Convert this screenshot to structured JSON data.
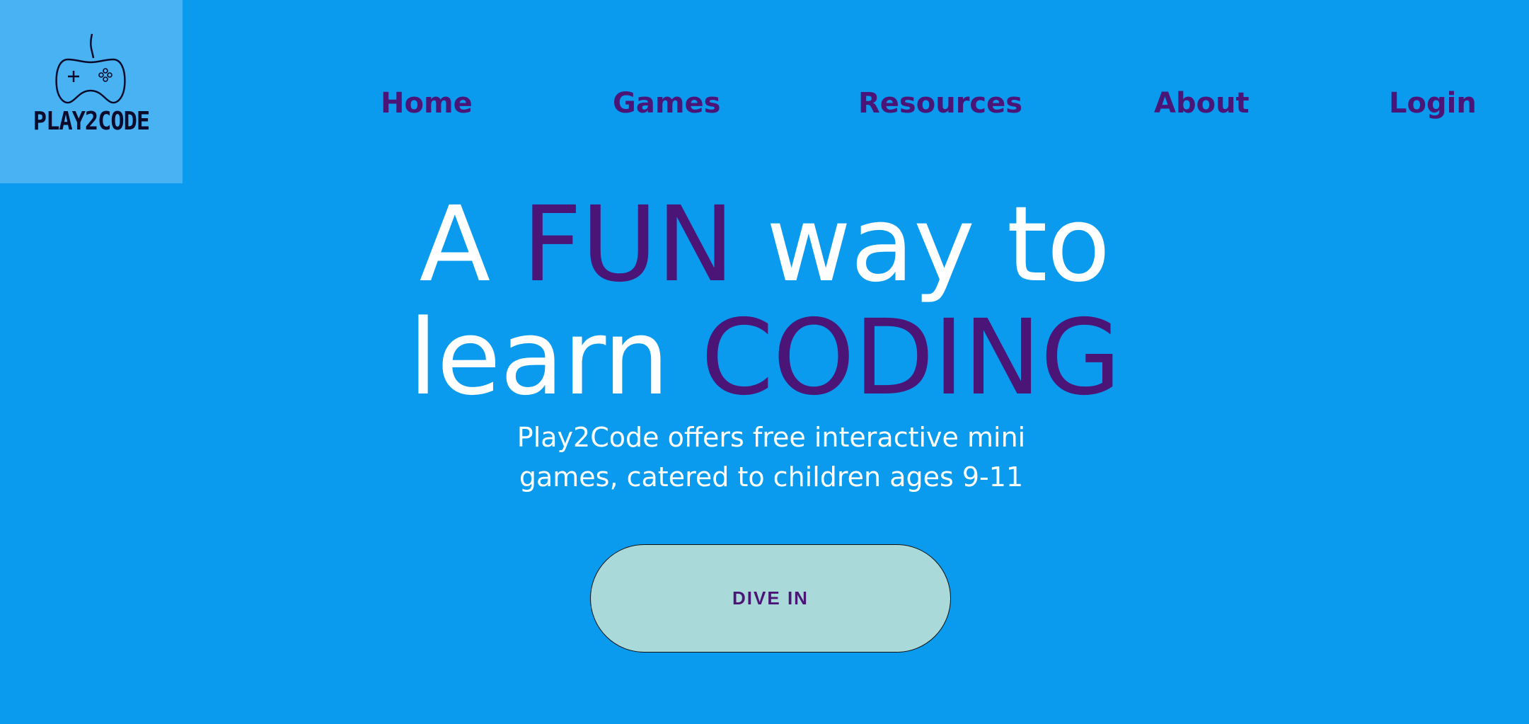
{
  "brand": {
    "logo_text": "PLAY2CODE",
    "logo_icon": "gamepad-icon",
    "logo_bg": "#49b2f2"
  },
  "nav": {
    "home": "Home",
    "games": "Games",
    "resources": "Resources",
    "about": "About",
    "login": "Login"
  },
  "hero": {
    "title_line1_part1": "A ",
    "title_line1_accent": "FUN",
    "title_line1_part2": " way to",
    "title_line2_part1": "learn ",
    "title_line2_accent": "CODING",
    "subtitle_line1": "Play2Code offers free interactive mini",
    "subtitle_line2": "games, catered to children ages 9-11",
    "cta_label": "DIVE IN"
  },
  "colors": {
    "background": "#0b9bee",
    "accent": "#4a1576",
    "text": "#ffffff",
    "button": "#a9d9d9"
  }
}
